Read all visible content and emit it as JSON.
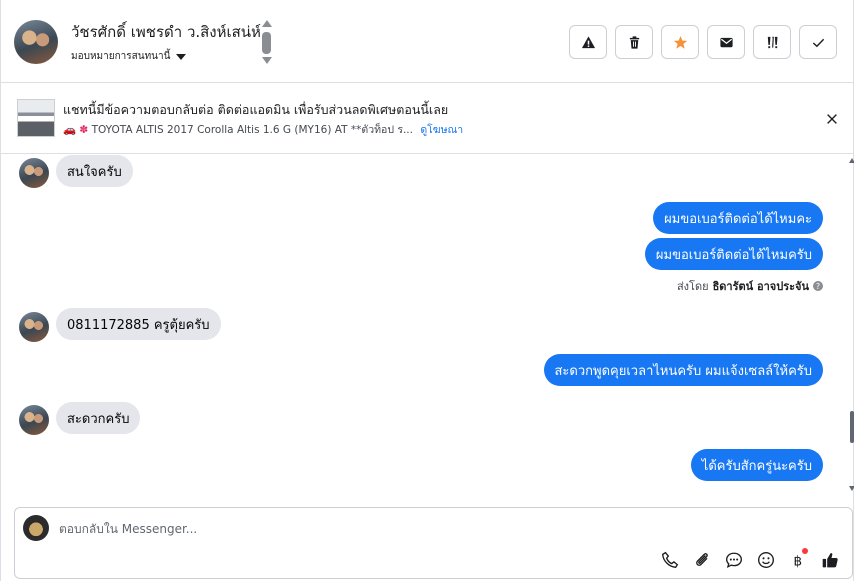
{
  "header": {
    "contact_name": "วัชรศักดิ์ เพชรดำ ว.สิงห์เสน่ห์",
    "assign_label": "มอบหมายการสนทนานี้",
    "actions": [
      {
        "name": "report-spam-button",
        "icon": "warning-icon"
      },
      {
        "name": "delete-button",
        "icon": "trash-icon"
      },
      {
        "name": "star-button",
        "icon": "star-icon"
      },
      {
        "name": "mark-unread-button",
        "icon": "envelope-icon"
      },
      {
        "name": "follow-up-button",
        "icon": "exclamation-icon"
      },
      {
        "name": "mark-done-button",
        "icon": "check-icon"
      }
    ],
    "star_color": "#f7923a"
  },
  "banner": {
    "title": "แชทนี้มีข้อความตอบกลับต่อ ติดต่อแอดมิน เพื่อรับส่วนลดพิเศษตอนนี้เลย",
    "subtitle": "TOYOTA ALTIS 2017 Corolla Altis 1.6 G (MY16) AT **ตัวท็อป ร...",
    "link": "ดูโฆษณา"
  },
  "messages": [
    {
      "dir": "in",
      "text": "สนใจครับ"
    },
    {
      "dir": "out",
      "text": "ผมขอเบอร์ติดต่อได้ไหมคะ"
    },
    {
      "dir": "out",
      "text": "ผมขอเบอร์ติดต่อได้ไหมครับ"
    },
    {
      "dir": "in",
      "text": "0811172885 ครูตุ้ยครับ"
    },
    {
      "dir": "out",
      "text": "สะดวกพูดคุยเวลาไหนครับ ผมแจ้งเซลล์ให้ครับ"
    },
    {
      "dir": "in",
      "text": "สะดวกครับ"
    },
    {
      "dir": "out",
      "text": "ได้ครับสักครู่นะครับ"
    }
  ],
  "sent_by": {
    "prefix": "ส่งโดย",
    "name": "ธิดารัตน์ อาจประจัน"
  },
  "composer": {
    "placeholder": "ตอบกลับใน Messenger...",
    "value": ""
  },
  "colors": {
    "outgoing_bubble": "#1877f2",
    "incoming_bubble": "#e4e6eb",
    "notification_dot": "#fa383e"
  }
}
